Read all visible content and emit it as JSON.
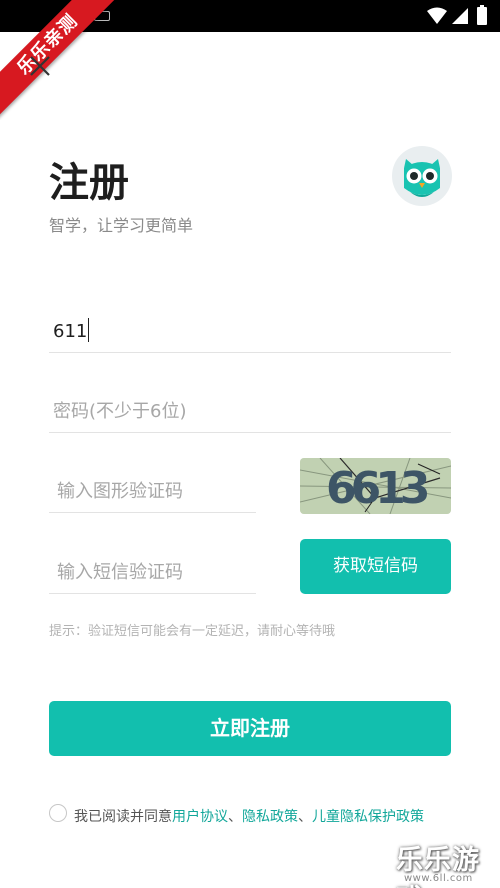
{
  "status_bar": {
    "icons": [
      "keyboard-icon",
      "wifi-icon",
      "signal-icon",
      "battery-icon"
    ]
  },
  "badge": {
    "text": "乐乐亲测"
  },
  "header": {
    "title": "注册",
    "subtitle": "智学，让学习更简单"
  },
  "form": {
    "phone": {
      "value": "611",
      "placeholder": ""
    },
    "password": {
      "value": "",
      "placeholder": "密码(不少于6位)"
    },
    "captcha": {
      "value": "",
      "placeholder": "输入图形验证码",
      "image_text": "6613"
    },
    "sms": {
      "value": "",
      "placeholder": "输入短信验证码",
      "button_label": "获取短信码"
    },
    "hint": "提示：验证短信可能会有一定延迟，请耐心等待哦",
    "submit_label": "立即注册"
  },
  "agreement": {
    "prefix": "我已阅读并同意",
    "link_user": "用户协议",
    "sep1": "、",
    "link_privacy": "隐私政策",
    "sep2": "、",
    "link_child": "儿童隐私保护政策"
  },
  "watermark": {
    "text": "乐乐游戏",
    "url": "www.6ll.com"
  },
  "colors": {
    "accent": "#12bfae",
    "badge": "#d71920",
    "link": "#12a79a"
  }
}
